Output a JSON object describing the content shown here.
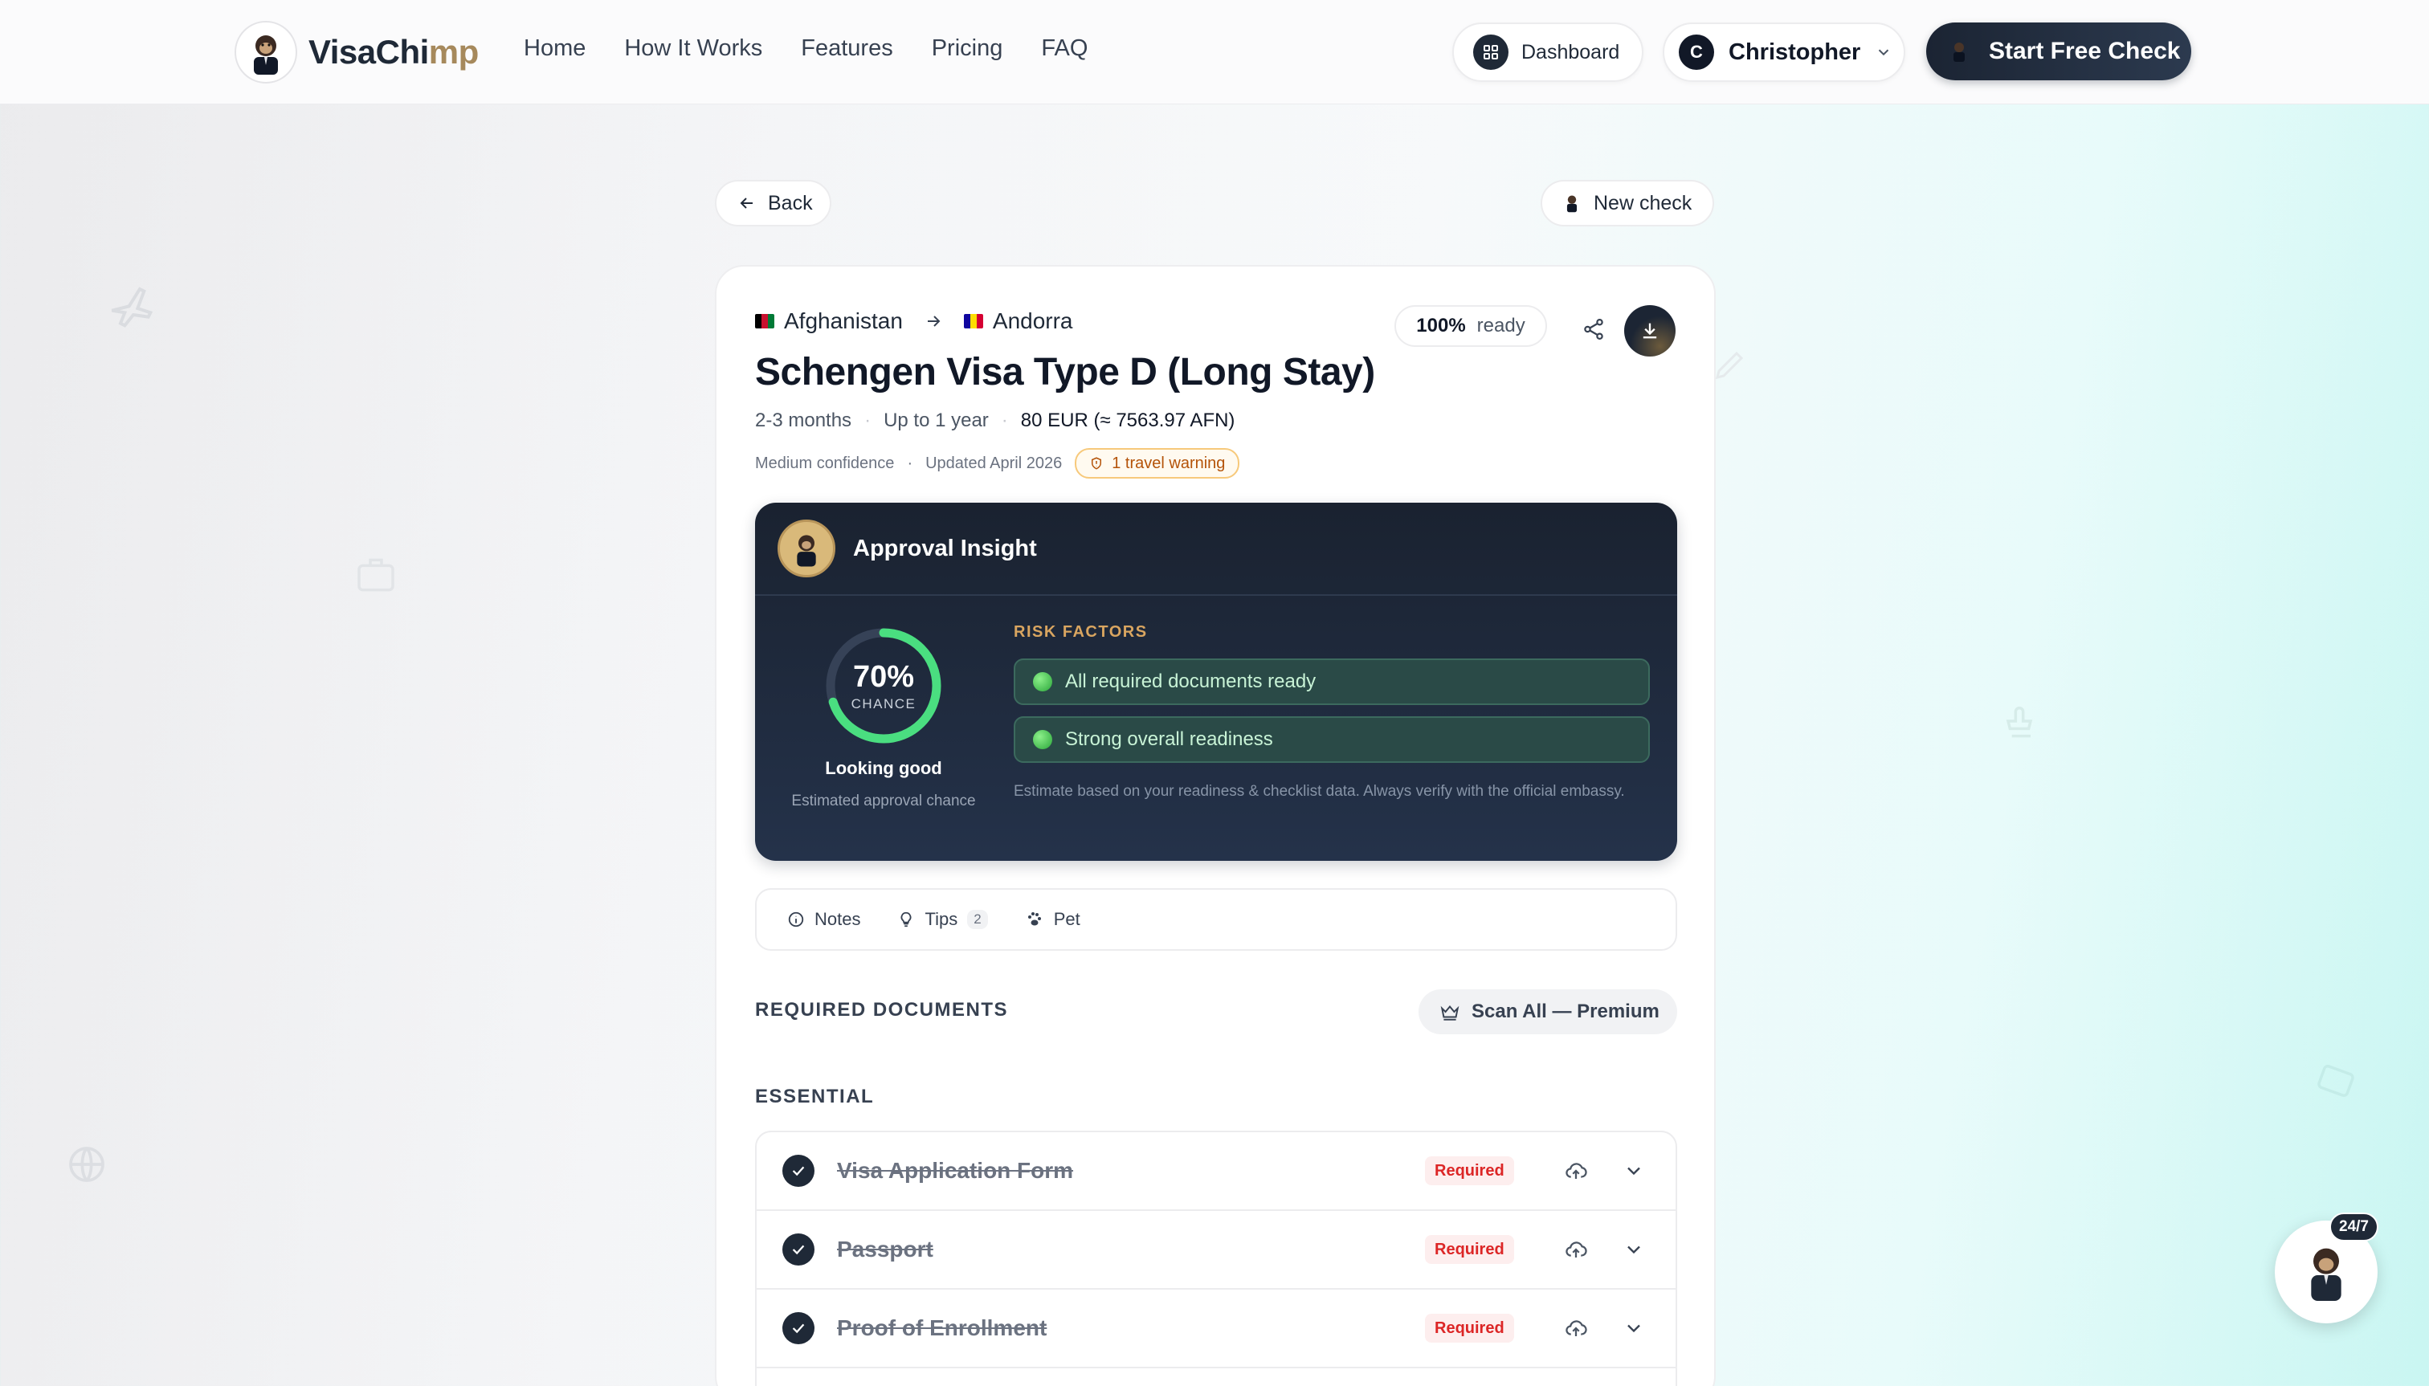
{
  "brand": {
    "name_part1": "VisaChi",
    "name_part2": "mp"
  },
  "nav": {
    "links": [
      "Home",
      "How It Works",
      "Features",
      "Pricing",
      "FAQ"
    ],
    "dashboard_label": "Dashboard",
    "user_initial": "C",
    "user_name": "Christopher",
    "cta_label": "Start Free Check"
  },
  "top_actions": {
    "back_label": "Back",
    "new_check_label": "New check"
  },
  "visa": {
    "from_country": "Afghanistan",
    "to_country": "Andorra",
    "readiness_value": "100%",
    "readiness_label": "ready",
    "title": "Schengen Visa Type D (Long Stay)",
    "processing_time": "2-3 months",
    "validity": "Up to 1 year",
    "fee": "80 EUR (≈ 7563.97 AFN)",
    "confidence": "Medium confidence",
    "updated": "Updated April 2026",
    "warning": "1 travel warning"
  },
  "insight": {
    "title": "Approval Insight",
    "chance_value": "70%",
    "chance_progress": 0.7,
    "chance_label": "CHANCE",
    "verdict": "Looking good",
    "verdict_sub": "Estimated approval chance",
    "risk_title": "RISK FACTORS",
    "risk_factors": [
      "All required documents ready",
      "Strong overall readiness"
    ],
    "disclaimer": "Estimate based on your readiness & checklist data. Always verify with the official embassy."
  },
  "tabs": {
    "notes": "Notes",
    "tips": "Tips",
    "tips_count": "2",
    "pet": "Pet"
  },
  "documents": {
    "section_title": "REQUIRED DOCUMENTS",
    "scan_label": "Scan All — Premium",
    "group_title": "ESSENTIAL",
    "items": [
      {
        "name": "Visa Application Form",
        "badge": "Required"
      },
      {
        "name": "Passport",
        "badge": "Required"
      },
      {
        "name": "Proof of Enrollment",
        "badge": "Required"
      }
    ]
  },
  "chat": {
    "badge": "24/7"
  },
  "colors": {
    "accent_dark": "#1f2937",
    "ring_green": "#4ade80",
    "required_red": "#dc2626",
    "warning_amber": "#b45309"
  }
}
